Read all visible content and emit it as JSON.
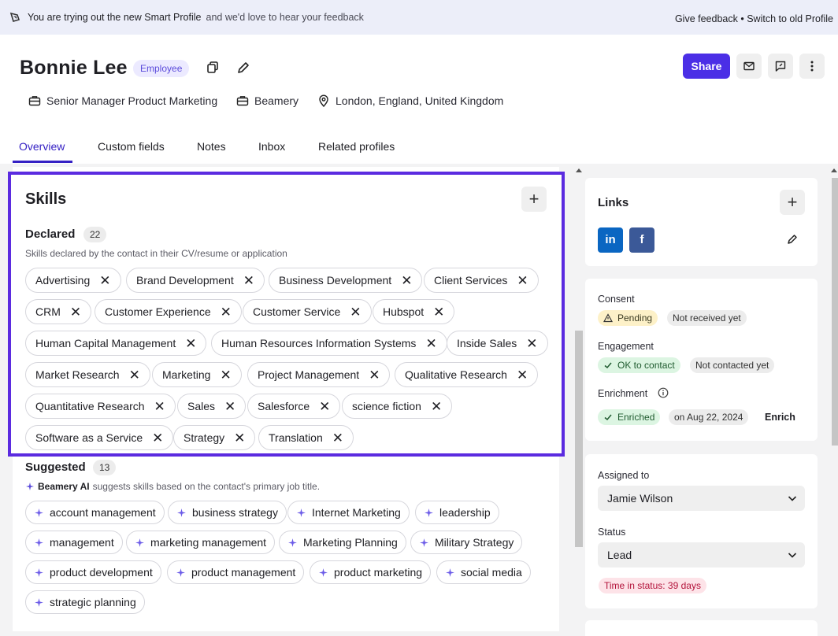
{
  "banner": {
    "message_bold": "You are trying out the new Smart Profile",
    "message_rest": "and we'd love to hear your feedback",
    "give_feedback": "Give feedback",
    "separator": "•",
    "switch_old": "Switch to old Profile"
  },
  "profile": {
    "name": "Bonnie Lee",
    "badge": "Employee",
    "title": "Senior Manager Product Marketing",
    "company": "Beamery",
    "location": "London, England, United Kingdom"
  },
  "actions": {
    "share": "Share"
  },
  "tabs": [
    "Overview",
    "Custom fields",
    "Notes",
    "Inbox",
    "Related profiles"
  ],
  "skills": {
    "title": "Skills",
    "declared": {
      "label": "Declared",
      "count": "22",
      "description": "Skills declared by the contact in their CV/resume or application",
      "items": [
        "Advertising",
        "Brand Development",
        "Business Development",
        "Client Services",
        "CRM",
        "Customer Experience",
        "Customer Service",
        "Hubspot",
        "Human Capital Management",
        "Human Resources Information Systems",
        "Inside Sales",
        "Market Research",
        "Marketing",
        "Project Management",
        "Qualitative Research",
        "Quantitative Research",
        "Sales",
        "Salesforce",
        "science fiction",
        "Software as a Service",
        "Strategy",
        "Translation"
      ]
    },
    "suggested": {
      "label": "Suggested",
      "count": "13",
      "ai_name": "Beamery AI",
      "description": "suggests skills based on the contact's primary job title.",
      "items": [
        "account management",
        "business strategy",
        "Internet Marketing",
        "leadership",
        "management",
        "marketing management",
        "Marketing Planning",
        "Military Strategy",
        "product development",
        "product management",
        "product marketing",
        "social media",
        "strategic planning"
      ]
    }
  },
  "links": {
    "title": "Links",
    "linkedin": "in",
    "facebook": "f"
  },
  "status_card": {
    "consent_label": "Consent",
    "consent_pending": "Pending",
    "consent_status": "Not received yet",
    "engagement_label": "Engagement",
    "engagement_ok": "OK to contact",
    "engagement_status": "Not contacted yet",
    "enrichment_label": "Enrichment",
    "enrichment_status": "Enriched",
    "enrichment_date": "on Aug 22, 2024",
    "enrich_action": "Enrich"
  },
  "assignment": {
    "assigned_label": "Assigned to",
    "assigned_value": "Jamie Wilson",
    "status_label": "Status",
    "status_value": "Lead",
    "time_in_status": "Time in status: 39 days"
  },
  "colors": {
    "accent": "#4b2fe6",
    "focus_border": "#5b2be0",
    "linkedin": "#0a66c2",
    "facebook": "#3b5998"
  }
}
